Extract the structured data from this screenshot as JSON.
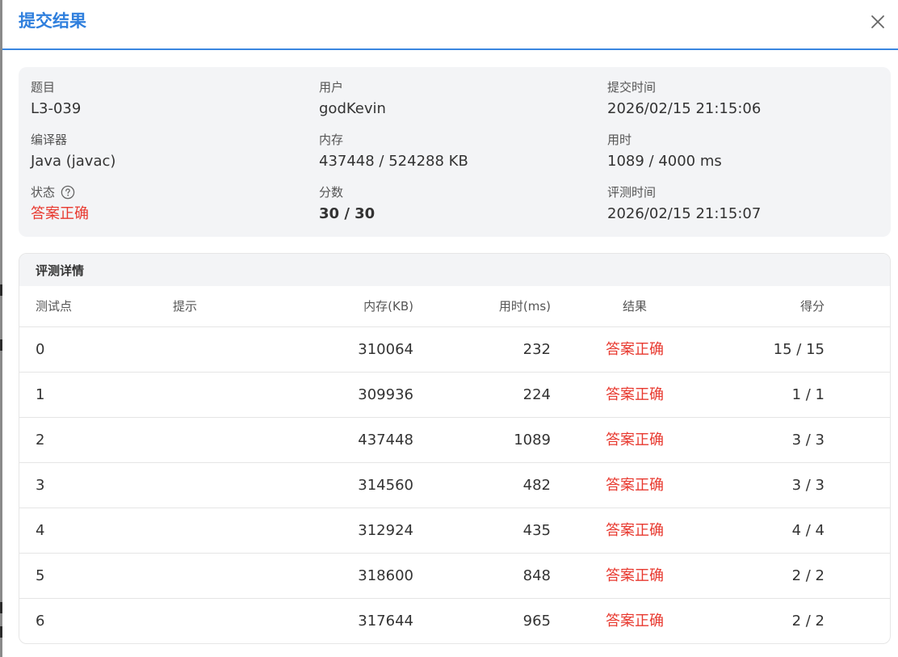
{
  "dialog": {
    "title": "提交结果",
    "close_icon": "close-icon"
  },
  "info": {
    "problem": {
      "label": "题目",
      "value": "L3-039"
    },
    "user": {
      "label": "用户",
      "value": "godKevin"
    },
    "submit_time": {
      "label": "提交时间",
      "value": "2026/02/15 21:15:06"
    },
    "compiler": {
      "label": "编译器",
      "value": "Java (javac)"
    },
    "memory": {
      "label": "内存",
      "value": "437448 / 524288 KB"
    },
    "time_used": {
      "label": "用时",
      "value": "1089 / 4000 ms"
    },
    "status": {
      "label": "状态",
      "value": "答案正确",
      "help_icon": "question-circle-icon"
    },
    "score": {
      "label": "分数",
      "value": "30 / 30"
    },
    "judge_time": {
      "label": "评测时间",
      "value": "2026/02/15 21:15:07"
    }
  },
  "details": {
    "title": "评测详情",
    "columns": [
      "测试点",
      "提示",
      "内存(KB)",
      "用时(ms)",
      "结果",
      "得分"
    ],
    "rows": [
      {
        "case": "0",
        "hint": "",
        "memory": "310064",
        "time": "232",
        "result": "答案正确",
        "score": "15 / 15"
      },
      {
        "case": "1",
        "hint": "",
        "memory": "309936",
        "time": "224",
        "result": "答案正确",
        "score": "1 / 1"
      },
      {
        "case": "2",
        "hint": "",
        "memory": "437448",
        "time": "1089",
        "result": "答案正确",
        "score": "3 / 3"
      },
      {
        "case": "3",
        "hint": "",
        "memory": "314560",
        "time": "482",
        "result": "答案正确",
        "score": "3 / 3"
      },
      {
        "case": "4",
        "hint": "",
        "memory": "312924",
        "time": "435",
        "result": "答案正确",
        "score": "4 / 4"
      },
      {
        "case": "5",
        "hint": "",
        "memory": "318600",
        "time": "848",
        "result": "答案正确",
        "score": "2 / 2"
      },
      {
        "case": "6",
        "hint": "",
        "memory": "317644",
        "time": "965",
        "result": "答案正确",
        "score": "2 / 2"
      }
    ]
  },
  "colors": {
    "accent": "#2f7fdd",
    "success_text": "#e8392f",
    "card_bg": "#f3f4f6"
  }
}
